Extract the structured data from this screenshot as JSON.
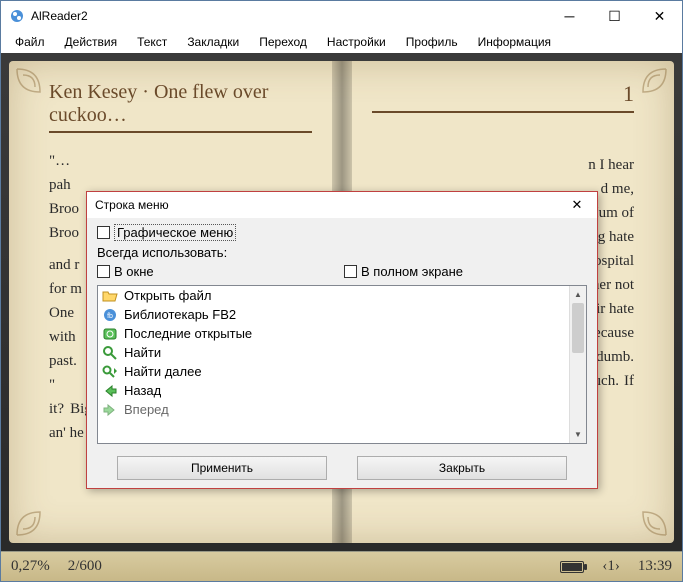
{
  "window": {
    "title": "AlReader2"
  },
  "menubar": {
    "items": [
      "Файл",
      "Действия",
      "Текст",
      "Закладки",
      "Переход",
      "Настройки",
      "Профиль",
      "Информация"
    ]
  },
  "book": {
    "header": "Ken Kesey  · One flew over cuckoo…",
    "page_number": "1",
    "left_text_1": "\"…",
    "left_text_2": "pah                                                ",
    "left_text_3": "Broo",
    "left_text_4": "Broo",
    "left_text_5": "and r",
    "left_text_6": "for m",
    "left_text_7": "One",
    "left_text_8": "with",
    "left_text_9": "past.",
    "left_text_10": "\"",
    "left_text_11": "it? Big enough to eat apples off my head an' he mine me like a",
    "right_text_1": "n I hear",
    "right_text_2": "d    me,",
    "right_text_3": "Hum   of",
    "right_text_4": "ng hate",
    "right_text_5": "hospital",
    "right_text_6": "her  not",
    "right_text_7": "eir hate",
    "right_text_8": "because",
    "right_text_9": "dumb.",
    "right_text_10": "n cagey enough to fool them that much. If my being half Indian ever"
  },
  "dialog": {
    "title": "Строка меню",
    "chk_graphic": "Графическое меню",
    "always_use": "Всегда использовать:",
    "chk_window": "В окне",
    "chk_fullscreen": "В полном экране",
    "items": [
      {
        "icon": "folder",
        "label": "Открыть файл"
      },
      {
        "icon": "fb2",
        "label": "Библиотекарь FB2"
      },
      {
        "icon": "recent",
        "label": "Последние открытые"
      },
      {
        "icon": "find",
        "label": "Найти"
      },
      {
        "icon": "findnext",
        "label": "Найти далее"
      },
      {
        "icon": "back",
        "label": "Назад"
      },
      {
        "icon": "fwd",
        "label": "Вперед"
      }
    ],
    "apply": "Применить",
    "close": "Закрыть"
  },
  "status": {
    "percent": "0,27%",
    "pages": "2/600",
    "chapter": "‹1›",
    "time": "13:39"
  }
}
